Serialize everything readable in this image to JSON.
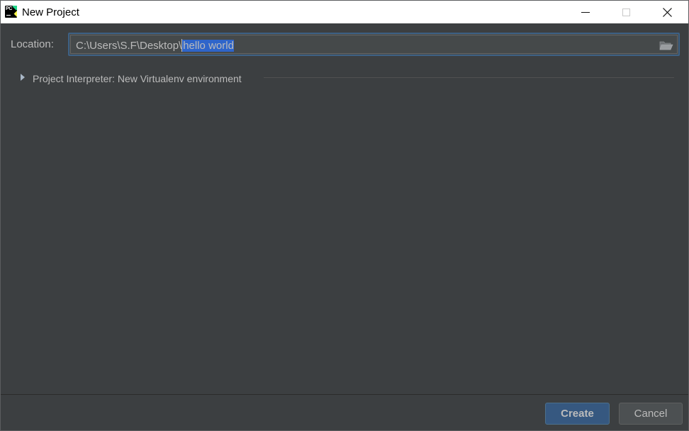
{
  "window": {
    "title": "New Project",
    "app_icon": "pycharm-icon",
    "app_icon_text": "PC"
  },
  "window_controls": {
    "minimize_icon": "minimize-icon",
    "maximize_icon": "maximize-icon",
    "close_icon": "close-icon"
  },
  "location": {
    "label": "Location:",
    "path_prefix": "C:\\Users\\S.F\\Desktop\\",
    "path_selected": "hello world",
    "browse_icon": "folder-icon"
  },
  "interpreter": {
    "expand_icon": "triangle-right-icon",
    "label": "Project Interpreter: New Virtualenv environment"
  },
  "footer": {
    "create_label": "Create",
    "cancel_label": "Cancel"
  },
  "colors": {
    "background": "#3c3f41",
    "text": "#bbbbbb",
    "selection": "#2f65ca",
    "focus_border": "#3d6185",
    "primary_button": "#365880"
  }
}
